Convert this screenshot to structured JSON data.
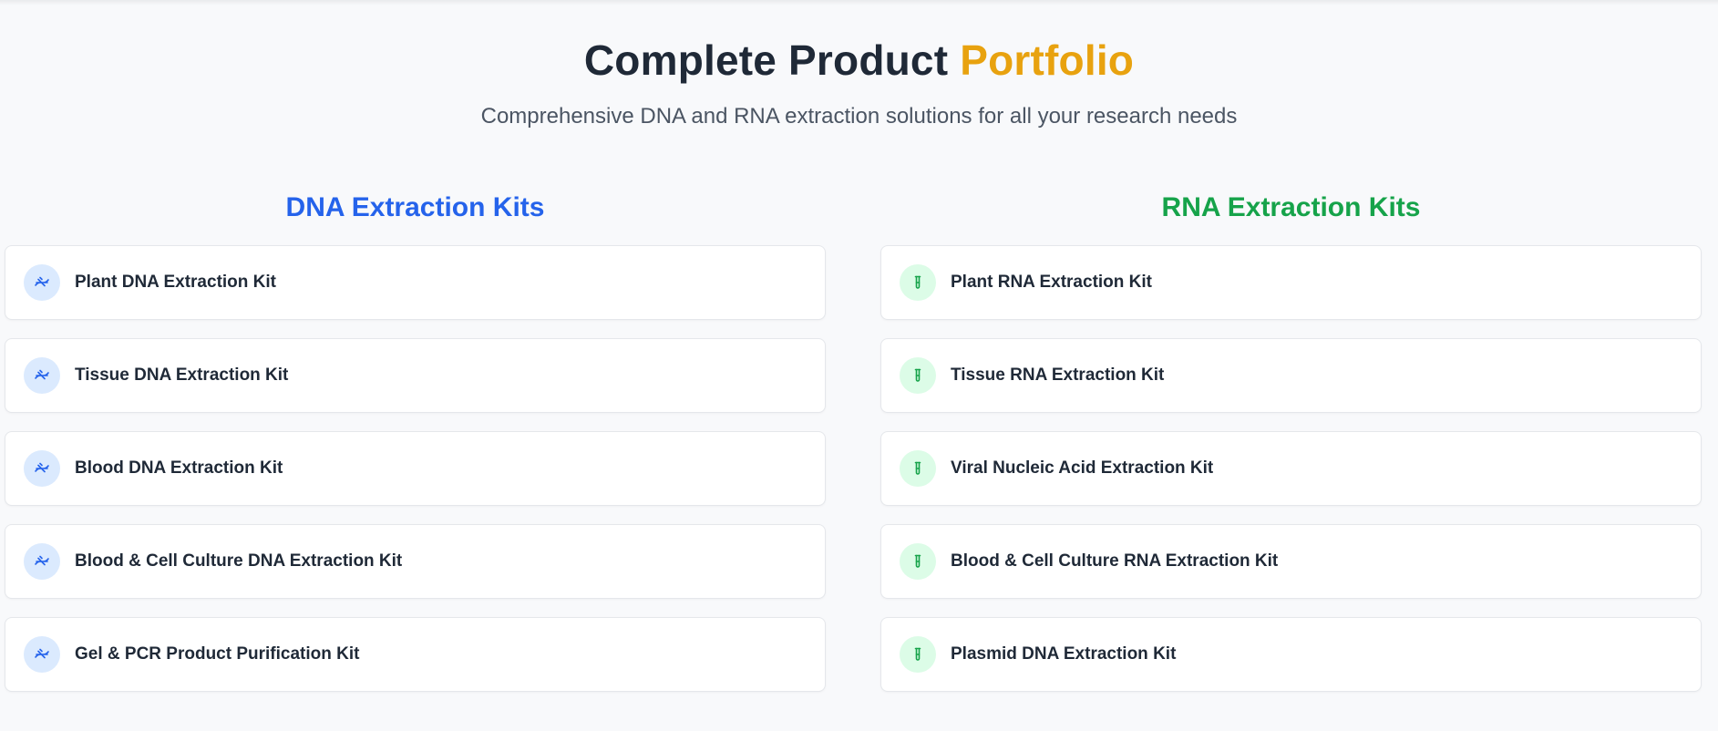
{
  "header": {
    "title_main": "Complete Product",
    "title_accent": "Portfolio",
    "subtitle": "Comprehensive DNA and RNA extraction solutions for all your research needs"
  },
  "colors": {
    "accent_gold": "#e8a20f",
    "dna_blue": "#2563eb",
    "rna_green": "#16a34a"
  },
  "dna": {
    "heading": "DNA Extraction Kits",
    "icon": "dna-icon",
    "items": [
      {
        "label": "Plant DNA Extraction Kit"
      },
      {
        "label": "Tissue DNA Extraction Kit"
      },
      {
        "label": "Blood DNA Extraction Kit"
      },
      {
        "label": "Blood & Cell Culture DNA Extraction Kit"
      },
      {
        "label": "Gel & PCR Product Purification Kit"
      }
    ]
  },
  "rna": {
    "heading": "RNA Extraction Kits",
    "icon": "test-tube-icon",
    "items": [
      {
        "label": "Plant RNA Extraction Kit"
      },
      {
        "label": "Tissue RNA Extraction Kit"
      },
      {
        "label": "Viral Nucleic Acid Extraction Kit"
      },
      {
        "label": "Blood & Cell Culture RNA Extraction Kit"
      },
      {
        "label": "Plasmid DNA Extraction Kit"
      }
    ]
  }
}
